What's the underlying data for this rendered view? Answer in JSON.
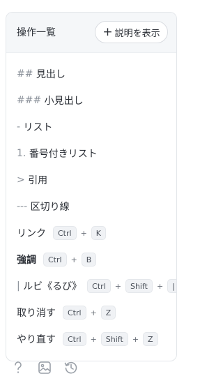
{
  "header": {
    "title": "操作一覧",
    "show_button": {
      "plus": "+",
      "label": "説明を表示"
    }
  },
  "rows": [
    {
      "mark": "##",
      "text": "見出し"
    },
    {
      "mark": "###",
      "text": "小見出し"
    },
    {
      "mark": "-",
      "text": "リスト"
    },
    {
      "mark": "1.",
      "text": "番号付きリスト"
    },
    {
      "mark": ">",
      "text": "引用"
    },
    {
      "mark": "---",
      "text": "区切り線"
    },
    {
      "text": "リンク",
      "keys": [
        "Ctrl",
        "K"
      ]
    },
    {
      "text": "強調",
      "keys": [
        "Ctrl",
        "B"
      ]
    },
    {
      "mark": "|",
      "text": "ルビ《るび》",
      "keys": [
        "Ctrl",
        "Shift",
        "|"
      ]
    },
    {
      "text": "取り消す",
      "keys": [
        "Ctrl",
        "Z"
      ]
    },
    {
      "text": "やり直す",
      "keys": [
        "Ctrl",
        "Shift",
        "Z"
      ]
    }
  ],
  "key_separator": "+",
  "toolbar": {
    "icons": [
      "question-icon",
      "image-icon",
      "history-icon"
    ]
  },
  "colors": {
    "text": "#2b2f36",
    "mark": "#8a9099",
    "header_bg": "#f5f7f9",
    "kbd_bg": "#f0f2f5",
    "icon": "#9aa0a8"
  }
}
